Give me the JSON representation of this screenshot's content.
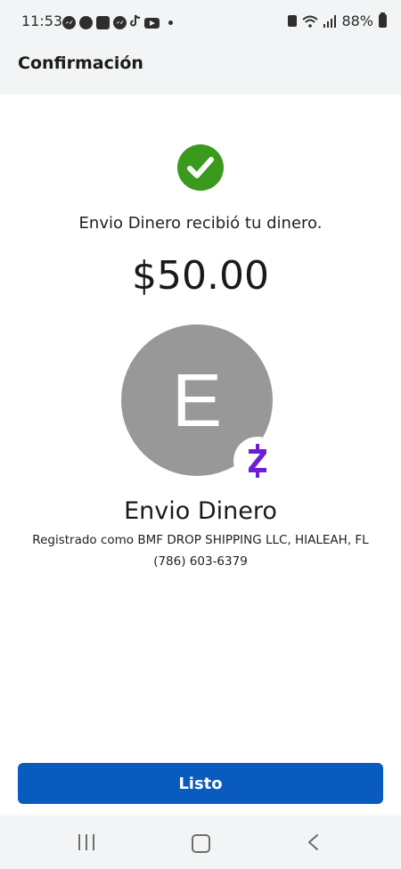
{
  "status_bar": {
    "time": "11:53",
    "battery": "88%",
    "app_icons": [
      "messenger-icon",
      "chat-icon",
      "app-square-icon",
      "messenger-icon",
      "tiktok-icon",
      "youtube-icon",
      "more-dot-icon"
    ],
    "right_icons": [
      "battery-saver-icon",
      "wifi-icon",
      "signal-icon",
      "battery-icon"
    ]
  },
  "header": {
    "title": "Confirmación"
  },
  "confirmation": {
    "message": "Envio Dinero recibió tu dinero.",
    "amount": "$50.00",
    "avatar_initial": "E",
    "badge_glyph": "Z",
    "recipient_name": "Envio Dinero",
    "registered_as": "Registrado como BMF DROP SHIPPING LLC, HIALEAH, FL",
    "phone": "(786) 603-6379"
  },
  "actions": {
    "done_label": "Listo"
  },
  "colors": {
    "success_green": "#3a9a1e",
    "primary_blue": "#0a5bbf",
    "zelle_purple": "#6d1ed4",
    "avatar_gray": "#989898"
  },
  "nav_bar": {
    "buttons": [
      "recents-icon",
      "home-icon",
      "back-icon"
    ]
  }
}
